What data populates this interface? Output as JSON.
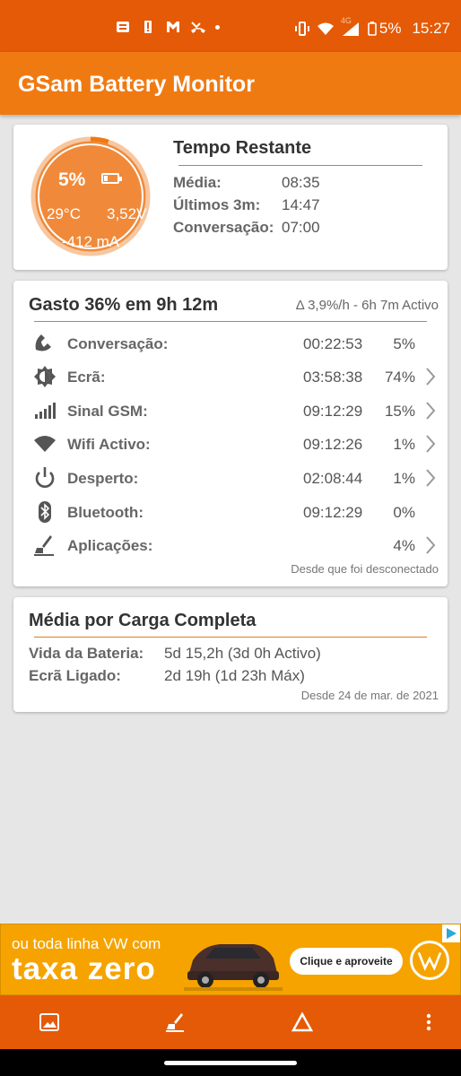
{
  "status_bar": {
    "icons_left": [
      "news-icon",
      "alert-icon",
      "gmail-icon",
      "missed-call-icon",
      "dot-icon"
    ],
    "network": "4G",
    "battery": "5%",
    "time": "15:27"
  },
  "app": {
    "title": "GSam Battery Monitor"
  },
  "gauge": {
    "level_fraction": 0.05,
    "percent": "5%",
    "temperature": "29°C",
    "voltage": "3,52V",
    "current": "-412 mA",
    "color": "#f07a12"
  },
  "remaining": {
    "title": "Tempo Restante",
    "rows": [
      {
        "label": "Média:",
        "value": "08:35"
      },
      {
        "label": "Últimos 3m:",
        "value": "14:47"
      },
      {
        "label": "Conversação:",
        "value": "07:00"
      }
    ]
  },
  "usage": {
    "title": "Gasto 36% em 9h 12m",
    "rate": "Δ 3,9%/h - 6h 7m Activo",
    "rows": [
      {
        "icon": "phone-icon",
        "name": "Conversação:",
        "time": "00:22:53",
        "percent": "5%",
        "chevron": false
      },
      {
        "icon": "brightness-icon",
        "name": "Ecrã:",
        "time": "03:58:38",
        "percent": "74%",
        "chevron": true
      },
      {
        "icon": "signal-icon",
        "name": "Sinal GSM:",
        "time": "09:12:29",
        "percent": "15%",
        "chevron": true
      },
      {
        "icon": "wifi-icon",
        "name": "Wifi Activo:",
        "time": "09:12:26",
        "percent": "1%",
        "chevron": true
      },
      {
        "icon": "power-icon",
        "name": "Desperto:",
        "time": "02:08:44",
        "percent": "1%",
        "chevron": true
      },
      {
        "icon": "bluetooth-icon",
        "name": "Bluetooth:",
        "time": "09:12:29",
        "percent": "0%",
        "chevron": false
      },
      {
        "icon": "broom-icon",
        "name": "Aplicações:",
        "time": "",
        "percent": "4%",
        "chevron": true
      }
    ],
    "footer": "Desde que foi desconectado"
  },
  "full_charge": {
    "title": "Média por Carga Completa",
    "rows": [
      {
        "label": "Vida da Bateria:",
        "value": "5d 15,2h (3d 0h Activo)"
      },
      {
        "label": "Ecrã Ligado:",
        "value": "2d 19h (1d 23h Máx)"
      }
    ],
    "footer": "Desde 24 de mar. de 2021"
  },
  "ad": {
    "line1": "ou toda linha VW com",
    "line2": "taxa zero",
    "cta": "Clique e aproveite"
  },
  "bottom_bar": {
    "icons": [
      "image-icon",
      "broom-icon",
      "delta-icon",
      "more-vert-icon"
    ]
  },
  "colors": {
    "status_bar": "#e55a06",
    "app_bar": "#f07a12",
    "accent": "#e07b1a"
  }
}
